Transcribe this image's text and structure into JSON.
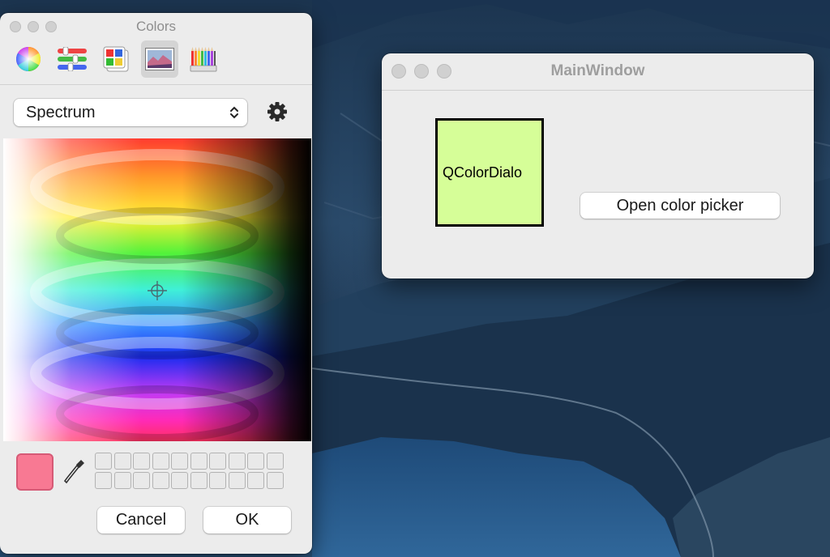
{
  "colors_panel": {
    "title": "Colors",
    "modes": [
      {
        "icon": "color-wheel-icon",
        "active": false
      },
      {
        "icon": "color-sliders-icon",
        "active": false
      },
      {
        "icon": "color-palettes-icon",
        "active": false
      },
      {
        "icon": "image-palettes-icon",
        "active": true
      },
      {
        "icon": "pencils-icon",
        "active": false
      }
    ],
    "palette_select": "Spectrum",
    "current_color": "#f87993",
    "swatch_rows": 2,
    "swatch_cols": 10,
    "cancel_label": "Cancel",
    "ok_label": "OK"
  },
  "main_window": {
    "title": "MainWindow",
    "color_box_text": "QColorDialo",
    "color_box_color": "#d6fe98",
    "open_button_label": "Open color picker"
  }
}
